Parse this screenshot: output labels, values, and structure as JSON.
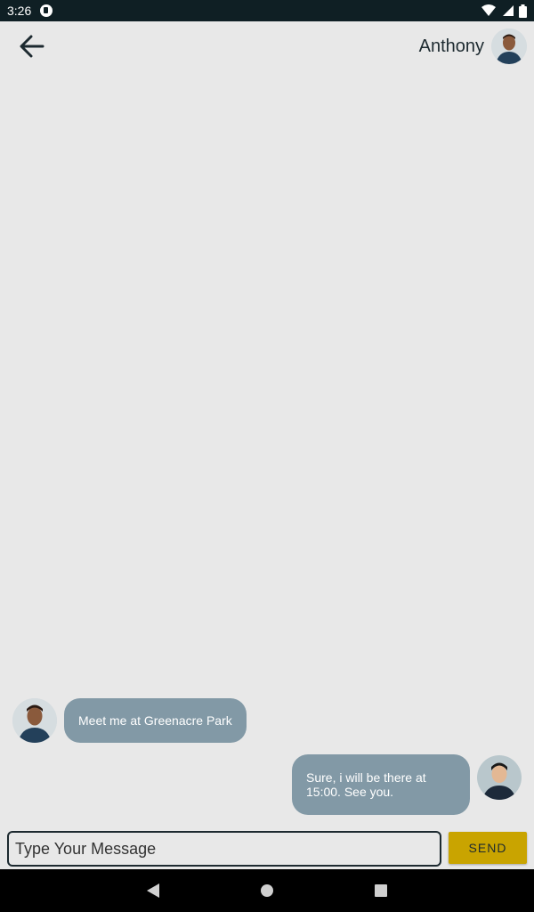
{
  "status_bar": {
    "time": "3:26",
    "icons": [
      "app-notification-icon",
      "wifi-icon",
      "cell-signal-icon",
      "battery-icon"
    ]
  },
  "header": {
    "back_icon": "arrow-left-icon",
    "contact_name": "Anthony"
  },
  "messages": [
    {
      "direction": "incoming",
      "text": "Meet me at Greenacre Park"
    },
    {
      "direction": "outgoing",
      "text": "Sure, i will be there at 15:00. See you."
    }
  ],
  "composer": {
    "placeholder": "Type Your Message",
    "send_label": "SEND"
  },
  "colors": {
    "bubble": "#8299a6",
    "send_button": "#c9a400",
    "background": "#e8e8e8"
  },
  "nav_bar": {
    "icons": [
      "back-triangle-icon",
      "home-circle-icon",
      "recents-square-icon"
    ]
  }
}
